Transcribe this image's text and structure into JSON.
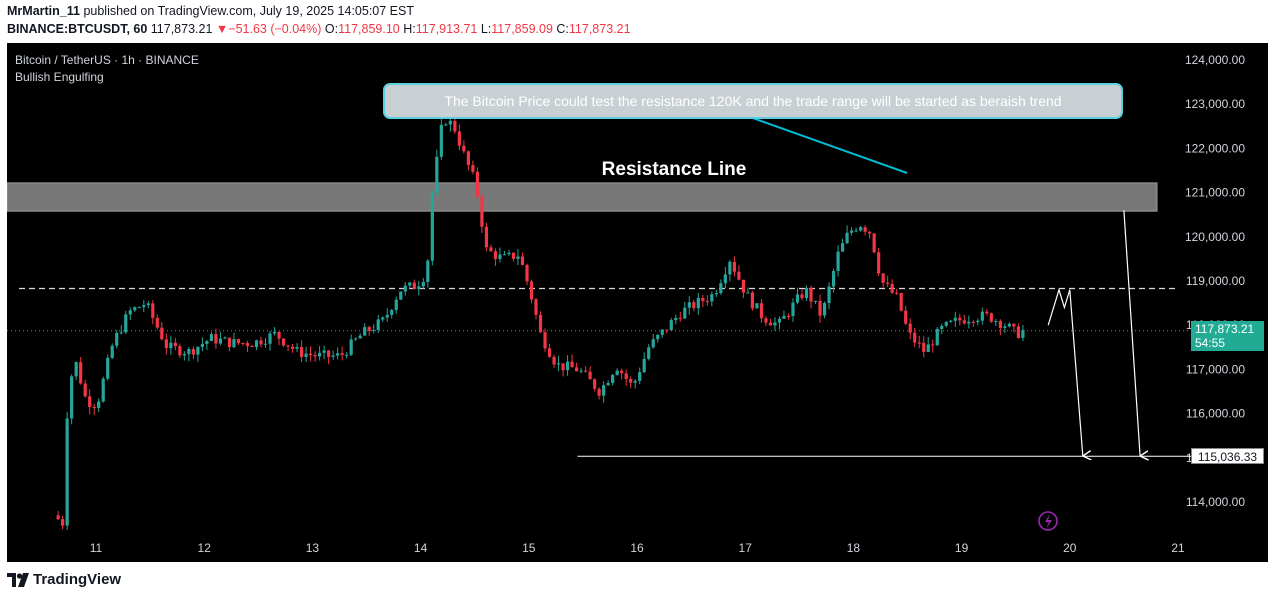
{
  "header": {
    "author": "MrMartin_11",
    "published": "published on TradingView.com, July 19, 2025 14:05:07 EST",
    "symbol": "BINANCE:BTCUSDT, 60",
    "last": "117,873.21",
    "change": "−51.63 (−0.04%)",
    "o_label": "O:",
    "o_value": "117,859.10",
    "h_label": "H:",
    "h_value": "117,913.71",
    "l_label": "L:",
    "l_value": "117,859.09",
    "c_label": "C:",
    "c_value": "117,873.21"
  },
  "chart_title": "Bitcoin / TetherUS · 1h · BINANCE",
  "indicator": "Bullish Engulfing",
  "annotation": "The Bitcoin Price could test the resistance 120K and the trade range will be started as beraish trend",
  "resistance_label": "Resistance Line",
  "price_tag": "117,873.21",
  "countdown": "54:55",
  "target_tag": "115,036.33",
  "brand": "TradingView",
  "colors": {
    "up": "#26a69a",
    "down": "#f23645",
    "bg": "#000000",
    "tag": "#22ab94"
  },
  "chart_data": {
    "type": "candlestick",
    "title": "Bitcoin / TetherUS · 1h · BINANCE",
    "x_ticks": [
      "11",
      "12",
      "13",
      "14",
      "15",
      "16",
      "17",
      "18",
      "19",
      "20",
      "21"
    ],
    "y_ticks": [
      "114,000.00",
      "115,000.00",
      "116,000.00",
      "117,000.00",
      "118,000.00",
      "119,000.00",
      "120,000.00",
      "121,000.00",
      "122,000.00",
      "123,000.00",
      "124,000.00"
    ],
    "ylim": [
      113300,
      124300
    ],
    "xlim": [
      10.45,
      21.3
    ],
    "resistance_zone": [
      120580,
      121220
    ],
    "range_top_level": 118830,
    "current_price": 117873.21,
    "target_price": 115036.33,
    "path": [
      [
        10.65,
        113700
      ],
      [
        10.75,
        113500
      ],
      [
        10.78,
        116500
      ],
      [
        10.85,
        117200
      ],
      [
        10.95,
        116300
      ],
      [
        11.05,
        116200
      ],
      [
        11.2,
        117600
      ],
      [
        11.35,
        118300
      ],
      [
        11.5,
        118500
      ],
      [
        11.7,
        117500
      ],
      [
        11.9,
        117400
      ],
      [
        12.1,
        117700
      ],
      [
        12.3,
        117600
      ],
      [
        12.5,
        117600
      ],
      [
        12.7,
        117800
      ],
      [
        12.9,
        117400
      ],
      [
        13.1,
        117300
      ],
      [
        13.3,
        117300
      ],
      [
        13.5,
        117800
      ],
      [
        13.7,
        118100
      ],
      [
        13.85,
        118800
      ],
      [
        14.0,
        118900
      ],
      [
        14.1,
        119200
      ],
      [
        14.15,
        121000
      ],
      [
        14.25,
        122700
      ],
      [
        14.35,
        122500
      ],
      [
        14.45,
        121800
      ],
      [
        14.55,
        121200
      ],
      [
        14.65,
        119700
      ],
      [
        14.8,
        119500
      ],
      [
        14.95,
        119600
      ],
      [
        15.05,
        118800
      ],
      [
        15.15,
        117800
      ],
      [
        15.3,
        117100
      ],
      [
        15.5,
        117000
      ],
      [
        15.7,
        116500
      ],
      [
        15.85,
        117100
      ],
      [
        16.0,
        116600
      ],
      [
        16.15,
        117500
      ],
      [
        16.3,
        117900
      ],
      [
        16.45,
        118300
      ],
      [
        16.6,
        118500
      ],
      [
        16.75,
        118700
      ],
      [
        16.9,
        119500
      ],
      [
        17.05,
        118700
      ],
      [
        17.2,
        118200
      ],
      [
        17.35,
        118000
      ],
      [
        17.5,
        118500
      ],
      [
        17.6,
        118800
      ],
      [
        17.75,
        118200
      ],
      [
        17.9,
        119600
      ],
      [
        18.0,
        120100
      ],
      [
        18.1,
        120300
      ],
      [
        18.2,
        120100
      ],
      [
        18.3,
        119000
      ],
      [
        18.45,
        118600
      ],
      [
        18.55,
        117800
      ],
      [
        18.7,
        117400
      ],
      [
        18.85,
        117900
      ],
      [
        19.0,
        118100
      ],
      [
        19.15,
        118200
      ],
      [
        19.3,
        118200
      ],
      [
        19.45,
        118000
      ],
      [
        19.55,
        117800
      ],
      [
        19.6,
        117873
      ]
    ],
    "forecast_paths": [
      [
        [
          19.8,
          118000
        ],
        [
          19.9,
          118800
        ],
        [
          19.95,
          118400
        ],
        [
          20.0,
          118800
        ],
        [
          20.12,
          115040
        ]
      ],
      [
        [
          20.5,
          120600
        ],
        [
          20.65,
          115040
        ]
      ]
    ]
  }
}
